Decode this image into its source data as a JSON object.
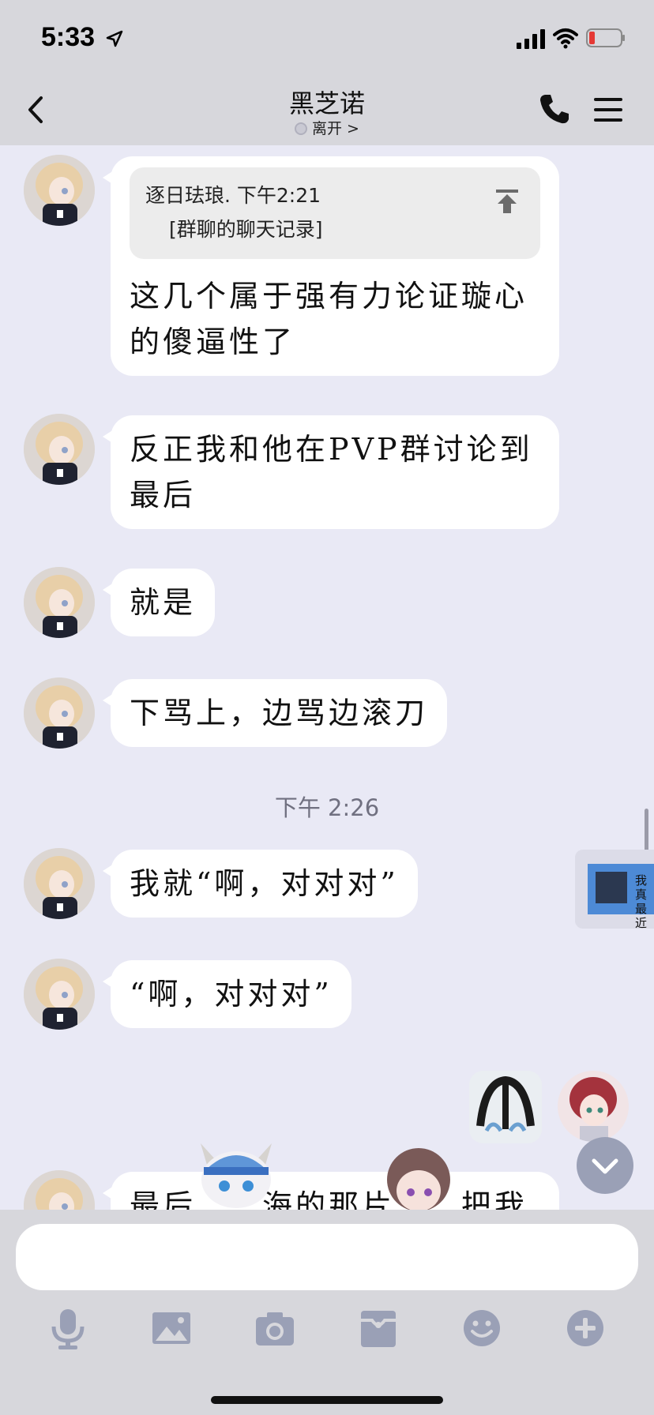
{
  "status_bar": {
    "time": "5:33"
  },
  "header": {
    "title": "黑芝诺",
    "status": "离开 >"
  },
  "messages": [
    {
      "quote": {
        "head": "逐日珐琅. 下午2:21",
        "body": "[群聊的聊天记录]"
      },
      "text": "这几个属于强有力论证璇心的傻逼性了"
    },
    {
      "text": "反正我和他在PVP群讨论到最后"
    },
    {
      "text": "就是"
    },
    {
      "text": "下骂上，边骂边滚刀"
    },
    {
      "time": "下午 2:26"
    },
    {
      "text": "我就“啊，对对对”"
    },
    {
      "text": "“啊，对对对”"
    },
    {
      "text": "最后……海的那片……把我拉"
    }
  ],
  "side_panel": {
    "label_line1": "我真",
    "label_line2": "最近"
  },
  "input": {
    "placeholder": ""
  },
  "toolbar": {
    "items": [
      "microphone-icon",
      "image-icon",
      "camera-icon",
      "inbox-icon",
      "emoji-icon",
      "plus-icon"
    ]
  },
  "colors": {
    "background": "#e9e9f5",
    "bar": "#d7d7dc",
    "icon": "#9aa0b6",
    "bubble": "#ffffff"
  }
}
